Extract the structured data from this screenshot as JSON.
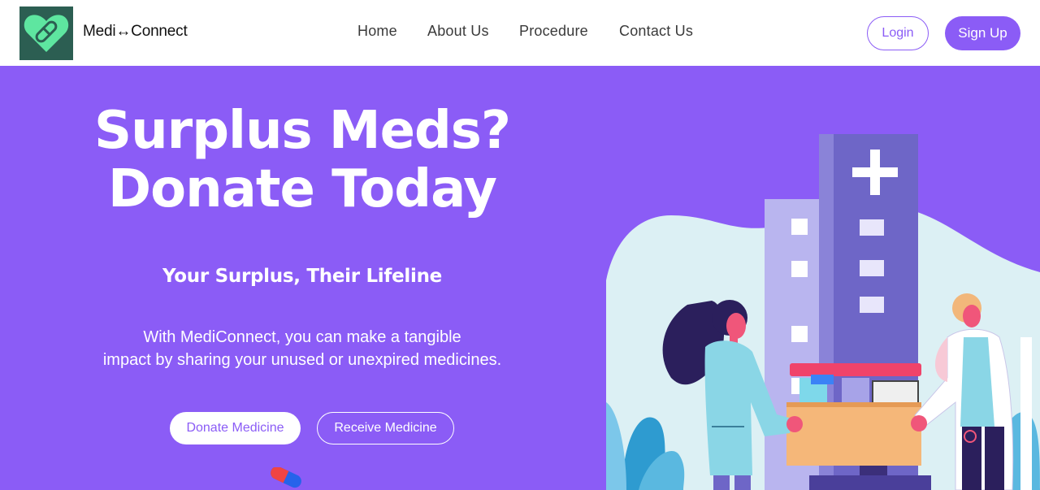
{
  "brand": {
    "name": "Medi↔Connect"
  },
  "nav": {
    "items": [
      {
        "label": "Home"
      },
      {
        "label": "About Us"
      },
      {
        "label": "Procedure"
      },
      {
        "label": "Contact Us"
      }
    ],
    "login_label": "Login",
    "signup_label": "Sign Up"
  },
  "hero": {
    "title_line1": "Surplus Meds?",
    "title_line2": "Donate Today",
    "subtitle": "Your Surplus, Their Lifeline",
    "desc_line1": "With MediConnect, you can make a tangible",
    "desc_line2": "impact by sharing your unused or unexpired medicines.",
    "donate_label": "Donate Medicine",
    "receive_label": "Receive Medicine"
  },
  "icons": {
    "logo": "heart-pill-logo-icon",
    "illustration": "medicine-donation-illustration",
    "decoration": "pill-capsule-icon"
  },
  "colors": {
    "accent": "#8b5cf6",
    "logo_bg": "#2c5e52",
    "logo_mark": "#5ee6a0"
  }
}
